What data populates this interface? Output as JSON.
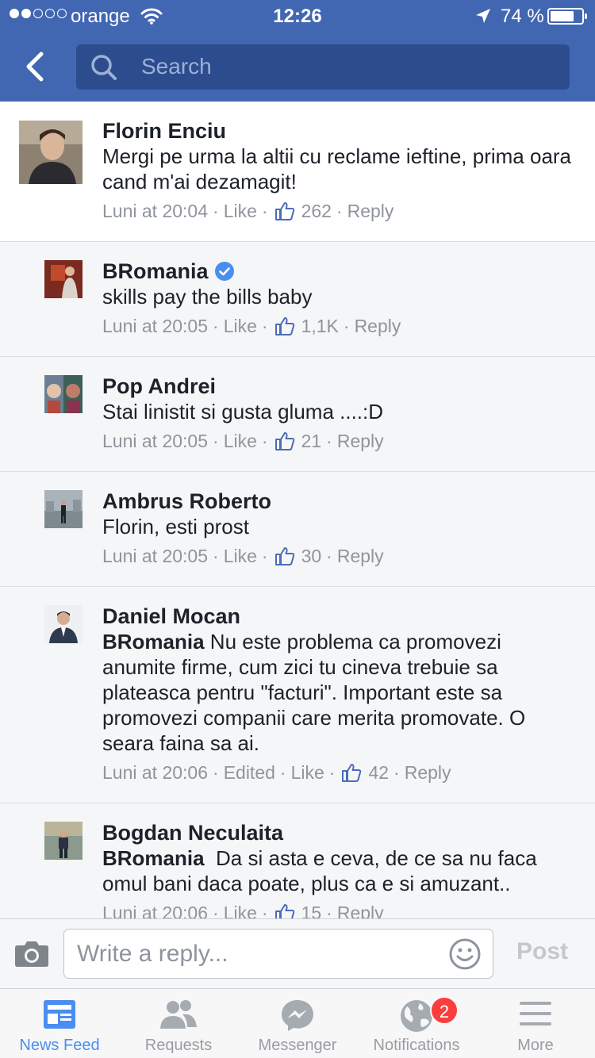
{
  "status_bar": {
    "carrier": "orange",
    "time": "12:26",
    "battery": "74 %",
    "battery_level": 0.74,
    "signal_bars_filled": 2,
    "signal_bars_total": 5
  },
  "header": {
    "search_placeholder": "Search",
    "back_icon": "chevron-left-icon",
    "search_icon": "search-icon"
  },
  "comments": [
    {
      "name": "Florin Enciu",
      "text": "Mergi pe urma la altii cu reclame ieftine, prima oara cand m'ai dezamagit!",
      "time": "Luni at 20:04",
      "like": "Like",
      "likes": "262",
      "reply": "Reply"
    },
    {
      "name": "BRomania",
      "verified": true,
      "text": "skills pay the bills baby",
      "time": "Luni at 20:05",
      "like": "Like",
      "likes": "1,1K",
      "reply": "Reply"
    },
    {
      "name": "Pop Andrei",
      "text": "Stai linistit si gusta gluma ....:D",
      "time": "Luni at 20:05",
      "like": "Like",
      "likes": "21",
      "reply": "Reply"
    },
    {
      "name": "Ambrus Roberto",
      "text": "Florin, esti prost",
      "time": "Luni at 20:05",
      "like": "Like",
      "likes": "30",
      "reply": "Reply"
    },
    {
      "name": "Daniel Mocan",
      "mention": "BRomania",
      "text": " Nu este problema ca promovezi anumite firme, cum zici tu cineva trebuie sa plateasca pentru \"facturi\". Important este sa promovezi companii care merita promovate. O seara faina sa ai.",
      "time": "Luni at 20:06",
      "edited": "Edited",
      "like": "Like",
      "likes": "42",
      "reply": "Reply"
    },
    {
      "name": "Bogdan Neculaita",
      "mention": "BRomania",
      "text": "  Da si asta e ceva, de ce sa nu faca omul bani daca poate, plus ca e si amuzant..",
      "time": "Luni at 20:06",
      "like": "Like",
      "likes": "15",
      "reply": "Reply"
    }
  ],
  "composer": {
    "placeholder": "Write a reply...",
    "post_label": "Post"
  },
  "tabs": [
    {
      "label": "News Feed",
      "icon": "news-feed-icon",
      "active": true
    },
    {
      "label": "Requests",
      "icon": "friends-icon"
    },
    {
      "label": "Messenger",
      "icon": "messenger-icon"
    },
    {
      "label": "Notifications",
      "icon": "globe-icon",
      "badge": "2"
    },
    {
      "label": "More",
      "icon": "menu-icon"
    }
  ],
  "colors": {
    "brand": "#4267b2",
    "search_bg": "#2d4c8e",
    "active_tab": "#4a8ef0",
    "badge": "#fa3e3e",
    "meta_text": "#90949c"
  }
}
